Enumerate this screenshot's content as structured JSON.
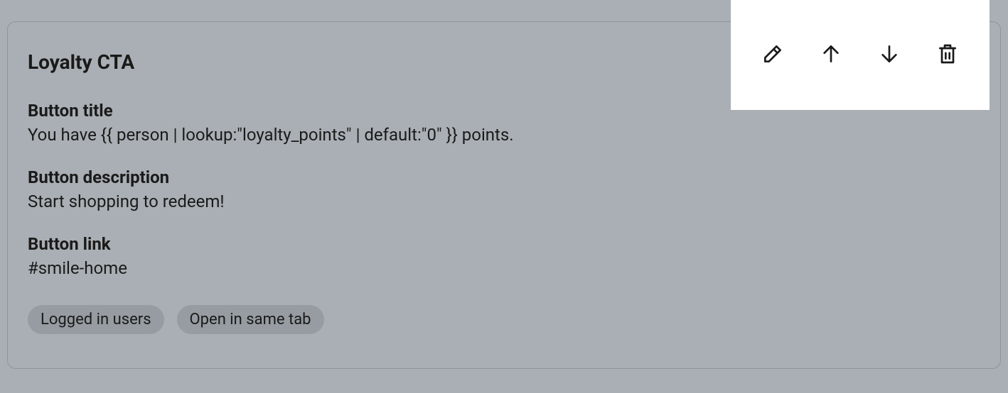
{
  "card": {
    "title": "Loyalty CTA",
    "fields": {
      "button_title": {
        "label": "Button title",
        "value": "You have {{ person | lookup:\"loyalty_points\" | default:\"0\" }} points."
      },
      "button_description": {
        "label": "Button description",
        "value": "Start shopping to redeem!"
      },
      "button_link": {
        "label": "Button link",
        "value": "#smile-home"
      }
    },
    "tags": [
      "Logged in users",
      "Open in same tab"
    ]
  },
  "toolbar": {
    "edit": "edit",
    "move_up": "move-up",
    "move_down": "move-down",
    "delete": "delete"
  }
}
